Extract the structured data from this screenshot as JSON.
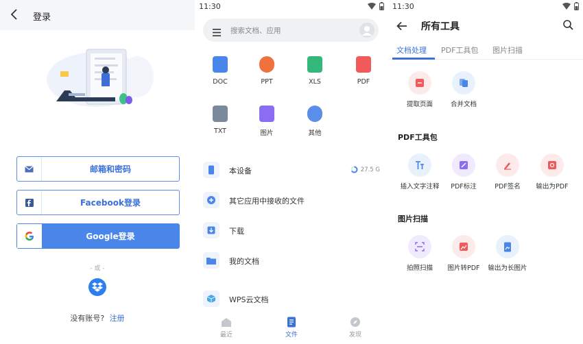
{
  "status": {
    "time": "11:30"
  },
  "login": {
    "title": "登录",
    "email_label": "邮箱和密码",
    "facebook_label": "Facebook登录",
    "google_label": "Google登录",
    "or_text": "- 或 -",
    "no_account_text": "没有账号?",
    "register_link": "注册"
  },
  "files": {
    "search_placeholder": "搜索文档、应用",
    "categories": [
      {
        "label": "DOC",
        "color": "#4a86ea"
      },
      {
        "label": "PPT",
        "color": "#f0713e"
      },
      {
        "label": "XLS",
        "color": "#34b77a"
      },
      {
        "label": "PDF",
        "color": "#f05a5a"
      },
      {
        "label": "TXT",
        "color": "#7a8a9c"
      },
      {
        "label": "图片",
        "color": "#8c6cf0"
      },
      {
        "label": "其他",
        "color": "#5b8ee8"
      }
    ],
    "locations": [
      {
        "label": "本设备",
        "storage": "27.5 G"
      },
      {
        "label": "其它应用中接收的文件"
      },
      {
        "label": "下载"
      },
      {
        "label": "我的文档"
      },
      {
        "label": "WPS云文档"
      }
    ],
    "nav": [
      {
        "label": "最近"
      },
      {
        "label": "文件"
      },
      {
        "label": "发现"
      }
    ]
  },
  "tools": {
    "title": "所有工具",
    "tabs": [
      {
        "label": "文档处理"
      },
      {
        "label": "PDF工具包"
      },
      {
        "label": "图片扫描"
      }
    ],
    "doc_tools": [
      {
        "label": "提取页面"
      },
      {
        "label": "合并文档"
      }
    ],
    "pdf_section_title": "PDF工具包",
    "pdf_tools": [
      {
        "label": "插入文字注释"
      },
      {
        "label": "PDF标注"
      },
      {
        "label": "PDF签名"
      },
      {
        "label": "输出为PDF"
      }
    ],
    "scan_section_title": "图片扫描",
    "scan_tools": [
      {
        "label": "拍照扫描"
      },
      {
        "label": "图片转PDF"
      },
      {
        "label": "输出为长图片"
      }
    ]
  },
  "colors": {
    "accent": "#3a70d8",
    "google_blue": "#4a86ea",
    "tool_red": "#f05a5a",
    "tool_blue": "#4a86ea",
    "tool_purple": "#8c6cf0"
  }
}
